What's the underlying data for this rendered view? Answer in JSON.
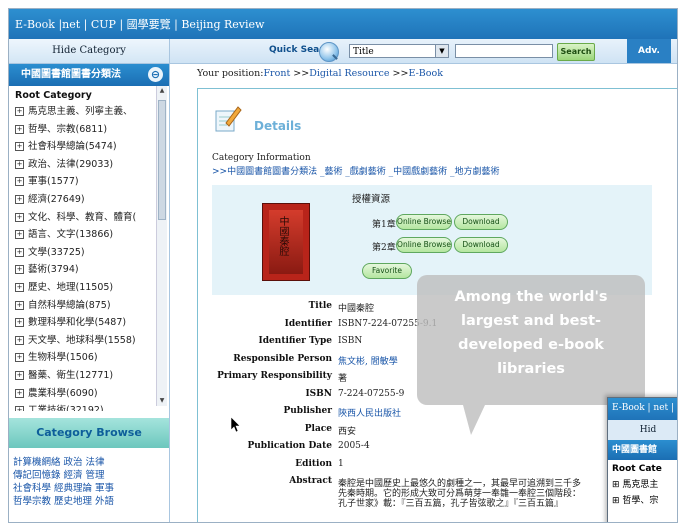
{
  "topbar": {
    "links": "E-Book |net | CUP | 國學要覽 | Beijing Review"
  },
  "navbar": {
    "hide_category": "Hide Category",
    "quick_search_label": "Quick Search",
    "select_value": "Title",
    "search_button": "Search",
    "adv": "Adv."
  },
  "sidebar": {
    "header": "中國圖書館圖書分類法",
    "header_icon": "⊖",
    "root": "Root Category",
    "items": [
      {
        "label": "馬克思主義、列寧主義、"
      },
      {
        "label": "哲學、宗教(6811)"
      },
      {
        "label": "社會科學總論(5474)"
      },
      {
        "label": "政治、法律(29033)"
      },
      {
        "label": "軍事(1577)"
      },
      {
        "label": "經濟(27649)"
      },
      {
        "label": "文化、科學、教育、體育("
      },
      {
        "label": "語言、文字(13866)"
      },
      {
        "label": "文學(33725)"
      },
      {
        "label": "藝術(3794)"
      },
      {
        "label": "歷史、地理(11505)"
      },
      {
        "label": "自然科學總論(875)"
      },
      {
        "label": "數理科學和化學(5487)"
      },
      {
        "label": "天文學、地球科學(1558)"
      },
      {
        "label": "生物科學(1506)"
      },
      {
        "label": "醫藥、衛生(12771)"
      },
      {
        "label": "農業科學(6090)"
      },
      {
        "label": "工業技術(32192)"
      }
    ],
    "category_browse": "Category Browse",
    "browse_links": [
      "計算機網絡 政治 法律",
      "傳記回憶錄 經濟 管理",
      "社會科學 經典理論 軍事",
      "哲學宗教 歷史地理 外語"
    ]
  },
  "breadcrumb": {
    "prefix": "Your position:",
    "front": "Front",
    "sep1": " >>",
    "digital": "Digital Resource",
    "sep2": " >>",
    "ebook": "E-Book"
  },
  "details": {
    "title": "Details",
    "category_info_label": "Category Information",
    "category_path": ">>中國圖書館圖書分類法 _藝術 _戲劇藝術 _中國戲劇藝術 _地方劇藝術",
    "access_title": "授權資源",
    "cover_text": "中國秦腔",
    "chapters": [
      {
        "label": "第1章",
        "online": "Online Browse",
        "download": "Download"
      },
      {
        "label": "第2章",
        "online": "Online Browse",
        "download": "Download"
      }
    ],
    "favorite": "Favorite"
  },
  "metadata": [
    {
      "key": "Title",
      "value": "中國秦腔",
      "link": false
    },
    {
      "key": "Identifier",
      "value": "ISBN7-224-07255-9.1",
      "link": false
    },
    {
      "key": "Identifier Type",
      "value": "ISBN",
      "link": false
    },
    {
      "key": "Responsible Person",
      "value": "焦文彬, 閻敏學",
      "link": true
    },
    {
      "key": "Primary Responsibility",
      "value": "著",
      "link": false
    },
    {
      "key": "ISBN",
      "value": "7-224-07255-9",
      "link": false
    },
    {
      "key": "Publisher",
      "value": "陝西人民出版社",
      "link": true
    },
    {
      "key": "Place",
      "value": "西安",
      "link": false
    },
    {
      "key": "Publication Date",
      "value": "2005-4",
      "link": false
    },
    {
      "key": "Edition",
      "value": "1",
      "link": false
    },
    {
      "key": "Abstract",
      "value": "秦腔是中國歷史上最悠久的劇種之一，其最早可追溯到三千多",
      "link": false
    },
    {
      "key": "",
      "value": "先秦時期。它的形成大致可分爲萌芽一奉雛一奉腔三個階段：",
      "link": false
    },
    {
      "key": "",
      "value": "孔子世家》載：『三百五篇，孔子皆弦歌之』『三百五篇』",
      "link": false
    }
  ],
  "callout": {
    "line1": "Among the world's",
    "line2": "largest and best-",
    "line3": "developed e-book",
    "line4": "libraries"
  },
  "mini": {
    "top": "E-Book | net |",
    "hide": "Hid",
    "header": "中國圖書館",
    "root": "Root Cate",
    "item1": "⊞ 馬克思主",
    "item2": "⊞ 哲學、宗"
  },
  "colors": {
    "accent": "#1f73b8",
    "link": "#1a56a8",
    "teal": "#6cc7bd"
  }
}
